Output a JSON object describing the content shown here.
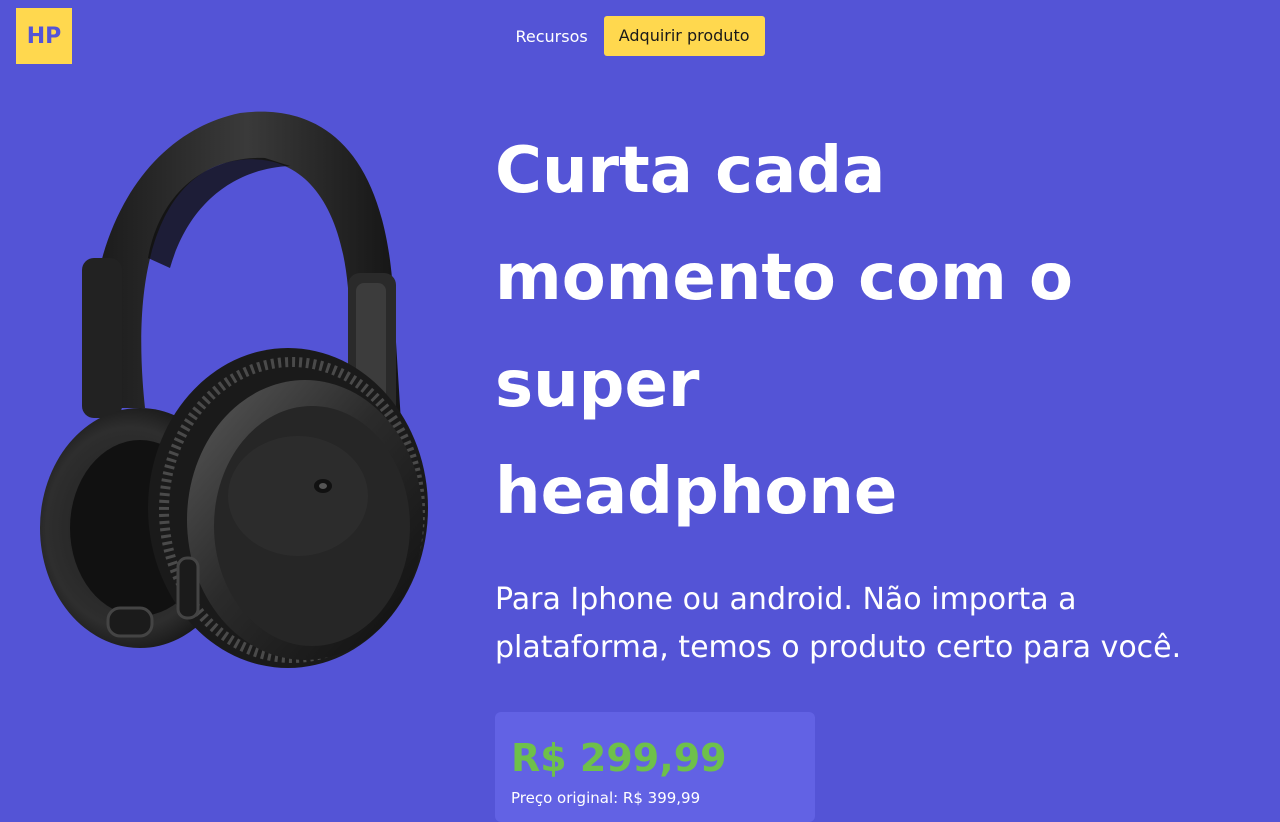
{
  "logo": {
    "text": "HP"
  },
  "nav": {
    "resources_label": "Recursos",
    "cta_label": "Adquirir produto"
  },
  "hero": {
    "title_lines": [
      "Curta cada",
      "momento com o",
      "super",
      "headphone"
    ],
    "subtitle_lines": [
      "Para Iphone ou android. Não importa a",
      "plataforma, temos o produto certo para você."
    ],
    "image_icon": "headphones-icon"
  },
  "pricing": {
    "price": "R$ 299,99",
    "original_price": "Preço original: R$ 399,99"
  },
  "colors": {
    "background": "#5454d6",
    "accent_yellow": "#ffd84e",
    "price_green": "#6ec04a",
    "card_bg": "#6262e4"
  }
}
